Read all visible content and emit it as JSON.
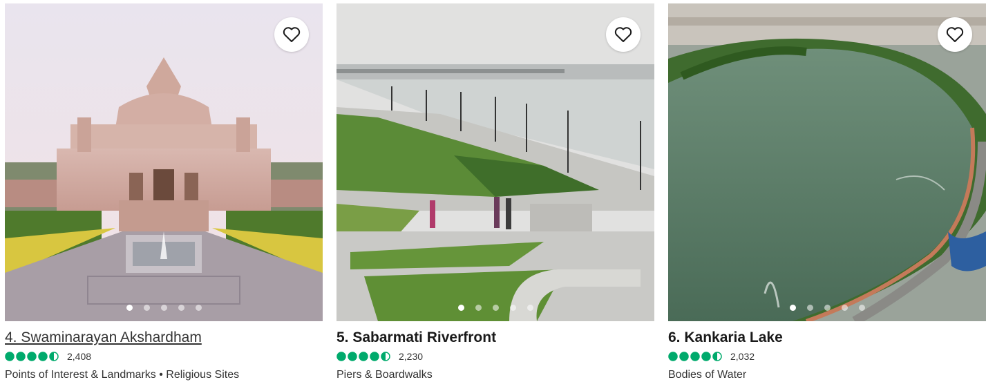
{
  "accent_color": "#00aa6c",
  "cards": [
    {
      "title": "4. Swaminarayan Akshardham",
      "rating": 4.5,
      "review_count": "2,408",
      "category": "Points of Interest & Landmarks • Religious Sites",
      "slides": 5,
      "active_slide": 1,
      "save_icon": "heart-outline-icon"
    },
    {
      "title": "5. Sabarmati Riverfront",
      "rating": 4.5,
      "review_count": "2,230",
      "category": "Piers & Boardwalks",
      "slides": 5,
      "active_slide": 1,
      "save_icon": "heart-outline-icon"
    },
    {
      "title": "6. Kankaria Lake",
      "rating": 4.5,
      "review_count": "2,032",
      "category": "Bodies of Water",
      "slides": 5,
      "active_slide": 1,
      "save_icon": "heart-outline-icon"
    }
  ]
}
